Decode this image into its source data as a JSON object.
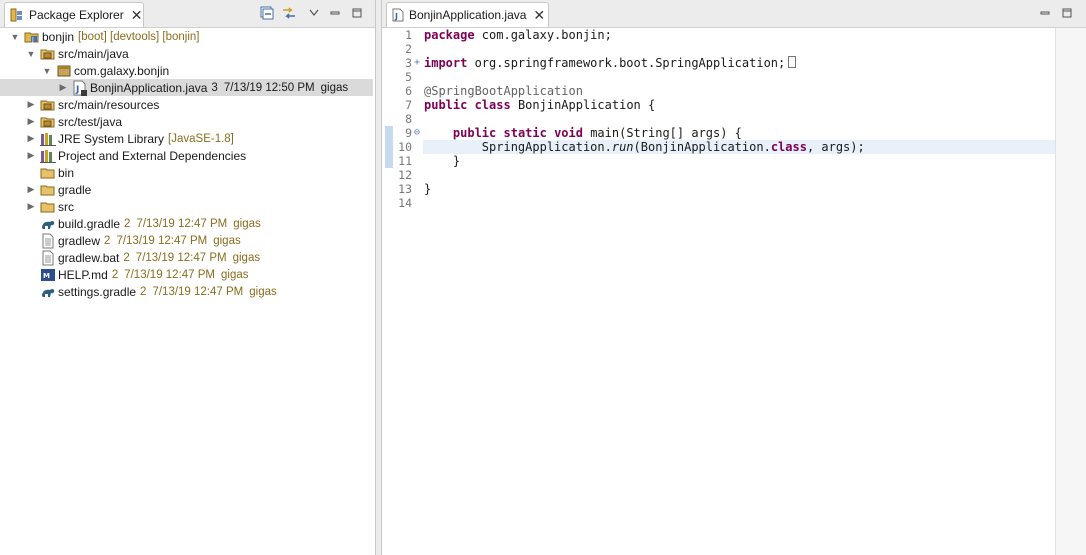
{
  "package_explorer": {
    "tab_title": "Package Explorer",
    "tree": [
      {
        "label": "bonjin",
        "deco": "[boot] [devtools] [bonjin]",
        "icon": "project-icon",
        "twisty": "open",
        "indent": 0
      },
      {
        "label": "src/main/java",
        "deco": "",
        "icon": "source-folder-icon",
        "twisty": "open",
        "indent": 1
      },
      {
        "label": "com.galaxy.bonjin",
        "deco": "",
        "icon": "package-icon",
        "twisty": "open",
        "indent": 2
      },
      {
        "label": "BonjinApplication.java",
        "deco_parts": [
          "3",
          "7/13/19 12:50 PM",
          "gigas"
        ],
        "icon": "java-file-icon",
        "twisty": "closed",
        "indent": 3,
        "selected": true,
        "plain_deco": true
      },
      {
        "label": "src/main/resources",
        "deco": "",
        "icon": "source-folder-icon",
        "twisty": "closed",
        "indent": 1
      },
      {
        "label": "src/test/java",
        "deco": "",
        "icon": "source-folder-icon",
        "twisty": "closed",
        "indent": 1
      },
      {
        "label": "JRE System Library",
        "deco": "[JavaSE-1.8]",
        "icon": "library-icon",
        "twisty": "closed",
        "indent": 1
      },
      {
        "label": "Project and External Dependencies",
        "deco": "",
        "icon": "library-icon",
        "twisty": "closed",
        "indent": 1
      },
      {
        "label": "bin",
        "deco": "",
        "icon": "folder-icon",
        "twisty": "none",
        "indent": 1
      },
      {
        "label": "gradle",
        "deco": "",
        "icon": "folder-icon",
        "twisty": "closed",
        "indent": 1
      },
      {
        "label": "src",
        "deco": "",
        "icon": "folder-icon",
        "twisty": "closed",
        "indent": 1
      },
      {
        "label": "build.gradle",
        "deco_parts": [
          "2",
          "7/13/19 12:47 PM",
          "gigas"
        ],
        "icon": "gradle-file-icon",
        "twisty": "none",
        "indent": 1
      },
      {
        "label": "gradlew",
        "deco_parts": [
          "2",
          "7/13/19 12:47 PM",
          "gigas"
        ],
        "icon": "text-file-icon",
        "twisty": "none",
        "indent": 1
      },
      {
        "label": "gradlew.bat",
        "deco_parts": [
          "2",
          "7/13/19 12:47 PM",
          "gigas"
        ],
        "icon": "text-file-icon",
        "twisty": "none",
        "indent": 1
      },
      {
        "label": "HELP.md",
        "deco_parts": [
          "2",
          "7/13/19 12:47 PM",
          "gigas"
        ],
        "icon": "markdown-file-icon",
        "twisty": "none",
        "indent": 1
      },
      {
        "label": "settings.gradle",
        "deco_parts": [
          "2",
          "7/13/19 12:47 PM",
          "gigas"
        ],
        "icon": "gradle-file-icon",
        "twisty": "none",
        "indent": 1
      }
    ]
  },
  "editor": {
    "tab_title": "BonjinApplication.java",
    "lines": [
      {
        "n": "1",
        "tokens": [
          [
            "kw",
            "package"
          ],
          [
            "",
            "com.galaxy.bonjin;"
          ]
        ]
      },
      {
        "n": "2",
        "tokens": []
      },
      {
        "n": "3",
        "fold": "+",
        "tokens": [
          [
            "kw",
            "import"
          ],
          [
            "",
            "org.springframework.boot.SpringApplication;"
          ]
        ]
      },
      {
        "n": "5",
        "tokens": []
      },
      {
        "n": "6",
        "tokens": [
          [
            "an",
            "@SpringBootApplication"
          ]
        ]
      },
      {
        "n": "7",
        "tokens": [
          [
            "kw",
            "public"
          ],
          [
            "kw",
            "class"
          ],
          [
            "",
            "BonjinApplication {"
          ]
        ]
      },
      {
        "n": "8",
        "tokens": []
      },
      {
        "n": "9",
        "fold": "⊖",
        "tokens": [
          [
            "",
            "    "
          ],
          [
            "kw",
            "public"
          ],
          [
            "kw",
            "static"
          ],
          [
            "kw",
            "void"
          ],
          [
            "",
            "main(String[] args) {"
          ]
        ]
      },
      {
        "n": "10",
        "current": true,
        "tokens": [
          [
            "",
            "        SpringApplication."
          ],
          [
            "it",
            "run"
          ],
          [
            "",
            "(BonjinApplication."
          ],
          [
            "kw",
            "class"
          ],
          [
            "",
            ", args);"
          ]
        ]
      },
      {
        "n": "11",
        "tokens": [
          [
            "",
            "    }"
          ]
        ]
      },
      {
        "n": "12",
        "tokens": []
      },
      {
        "n": "13",
        "tokens": [
          [
            "",
            "}"
          ]
        ]
      },
      {
        "n": "14",
        "tokens": []
      }
    ]
  }
}
